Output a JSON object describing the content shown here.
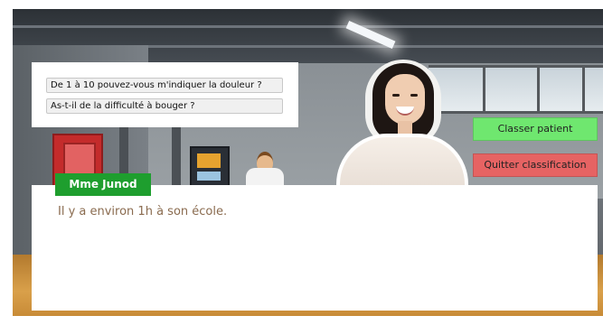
{
  "questions": {
    "items": [
      {
        "label": "De 1 à 10 pouvez-vous m'indiquer la douleur ?"
      },
      {
        "label": "As-t-il de la difficulté à bouger ?"
      }
    ]
  },
  "actions": {
    "classify_label": "Classer patient",
    "quit_label": "Quitter classification",
    "classify_color": "#6fe76f",
    "quit_color": "#e66363"
  },
  "dialog": {
    "speaker": "Mme Junod",
    "text": "Il y a environ 1h à son école.",
    "speaker_color": "#1e9e2e"
  }
}
